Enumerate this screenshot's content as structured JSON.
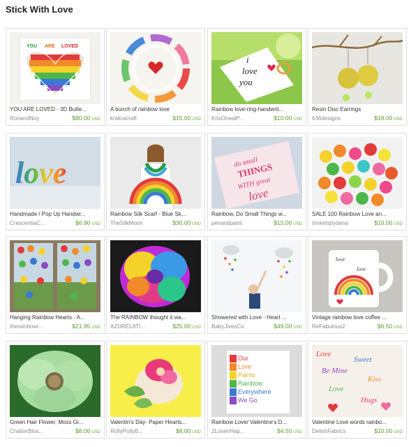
{
  "page": {
    "title": "Stick With Love"
  },
  "listings": [
    {
      "name": "YOU ARE LOVED - 3D Butte...",
      "shop": "RonandNoy",
      "price": "$80.00",
      "currency": "USD",
      "thumb_text": [
        "YOU",
        "ARE",
        "LOVED"
      ]
    },
    {
      "name": "A bunch of rainbow love",
      "shop": "krakracraft",
      "price": "$15.00",
      "currency": "USD"
    },
    {
      "name": "Rainbow love-ring-handwrit...",
      "shop": "KrisOnealP...",
      "price": "$10.00",
      "currency": "USD",
      "thumb_text": [
        "i",
        "love",
        "you"
      ]
    },
    {
      "name": "Resin Disc Earrings",
      "shop": "636designs",
      "price": "$18.00",
      "currency": "USD"
    },
    {
      "name": "Handmade / Pop Up Handwr...",
      "shop": "CrescentiaC...",
      "price": "$6.90",
      "currency": "USD",
      "thumb_text": [
        "love"
      ]
    },
    {
      "name": "Rainbow Silk Scarf - Blue Sk...",
      "shop": "TheSilkMoon",
      "price": "$30.00",
      "currency": "USD"
    },
    {
      "name": "Rainbow, Do Small Things w...",
      "shop": "penandpaint",
      "price": "$15.00",
      "currency": "USD",
      "thumb_text": [
        "do small",
        "THINGS",
        "WITH great",
        "love"
      ]
    },
    {
      "name": "SALE 100 Rainbow Love an...",
      "shop": "trinketsbydana",
      "price": "$10.00",
      "currency": "USD"
    },
    {
      "name": "Hanging Rainbow Hearts - A...",
      "shop": "therainbowr...",
      "price": "$21.95",
      "currency": "USD"
    },
    {
      "name": "The RAINBOW thought it wa...",
      "shop": "AZURELATI...",
      "price": "$25.00",
      "currency": "USD"
    },
    {
      "name": "Showered with Love - Heart ...",
      "shop": "BabyJivesCo",
      "price": "$49.00",
      "currency": "USD"
    },
    {
      "name": "Vintage rainbow love coffee ...",
      "shop": "ReFabulous2",
      "price": "$6.50",
      "currency": "USD",
      "thumb_text": [
        "love",
        "love"
      ]
    },
    {
      "name": "Green Hair Flower, Moss Gr...",
      "shop": "ChatterBlos...",
      "price": "$8.00",
      "currency": "USD"
    },
    {
      "name": "Valentin's Day- Paper Hearts...",
      "shop": "RollyPollyB...",
      "price": "$8.00",
      "currency": "USD"
    },
    {
      "name": "Rainbow Love/ Valentine's D...",
      "shop": "2LovenHap...",
      "price": "$4.50",
      "currency": "USD",
      "thumb_text": [
        "Our",
        "Love",
        "Paints",
        "Rainbow",
        "Everywhere",
        "We Go"
      ]
    },
    {
      "name": "Valentine Love words rainbo...",
      "shop": "DelishFabrics",
      "price": "$10.00",
      "currency": "USD",
      "thumb_text": [
        "Love",
        "Sweet",
        "Be Mine",
        "Kiss",
        "Love",
        "Hugs"
      ]
    }
  ]
}
